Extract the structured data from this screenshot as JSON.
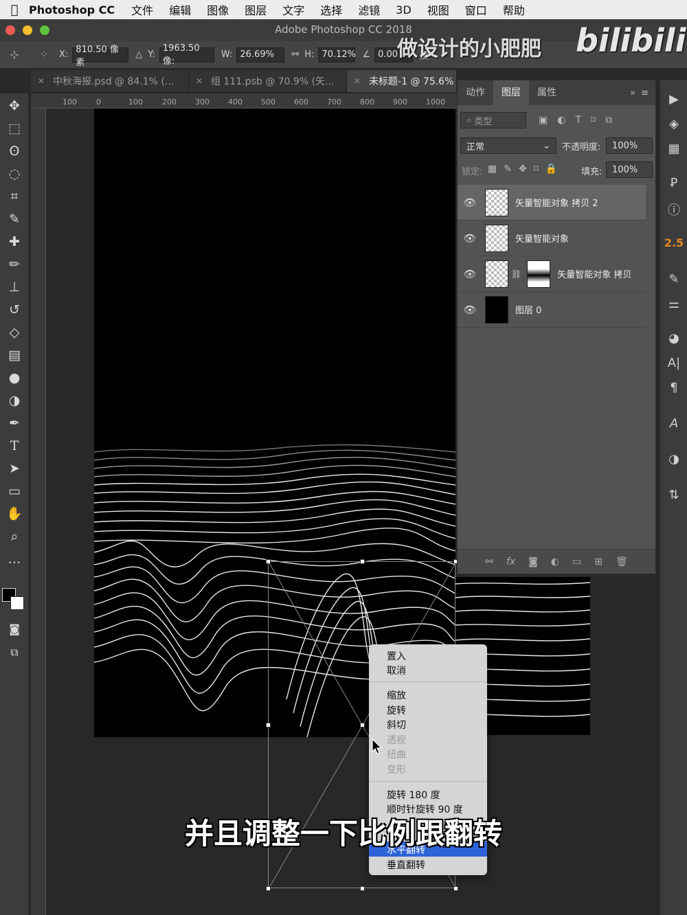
{
  "menubar": {
    "app": "Photoshop CC",
    "items": [
      "文件",
      "编辑",
      "图像",
      "图层",
      "文字",
      "选择",
      "滤镜",
      "3D",
      "视图",
      "窗口",
      "帮助"
    ]
  },
  "window_title": "Adobe Photoshop CC 2018",
  "options": {
    "x_label": "X:",
    "x_value": "810.50 像素",
    "y_label": "Y:",
    "y_value": "1963.50 像:",
    "w_label": "W:",
    "w_value": "26.69%",
    "h_label": "H:",
    "h_value": "70.12%",
    "angle_value": "0.00",
    "angle_unit": "度"
  },
  "doc_tabs": [
    {
      "label": "中秋海报.psd @ 84.1% (...",
      "active": false
    },
    {
      "label": "组 111.psb @ 70.9% (矢...",
      "active": false
    },
    {
      "label": "未标题-1 @ 75.6%",
      "active": true
    }
  ],
  "ruler_ticks": [
    "100",
    "0",
    "100",
    "200",
    "300",
    "400",
    "500",
    "600",
    "700",
    "800",
    "900",
    "1000"
  ],
  "panel": {
    "tabs": [
      "动作",
      "图层",
      "属性"
    ],
    "active_tab": "图层",
    "filter_placeholder": "类型",
    "blend_mode": "正常",
    "opacity_label": "不透明度:",
    "opacity_value": "100%",
    "lock_label": "锁定:",
    "fill_label": "填充:",
    "fill_value": "100%",
    "layers": [
      {
        "name": "矢量智能对象 拷贝 2",
        "selected": true
      },
      {
        "name": "矢量智能对象",
        "selected": false
      },
      {
        "name": "矢量智能对象 拷贝",
        "selected": false
      },
      {
        "name": "图层 0",
        "selected": false
      }
    ]
  },
  "context_menu": {
    "items": [
      "置入",
      "取消",
      "缩放",
      "旋转",
      "斜切",
      "透视",
      "扭曲",
      "变形",
      "旋转 180 度",
      "顺时针旋转 90 度",
      "水平翻转",
      "垂直翻转"
    ],
    "disabled": [
      "透视",
      "扭曲",
      "变形"
    ],
    "highlighted": "水平翻转"
  },
  "right_strip_value": "2.5",
  "subtitle": "并且调整一下比例跟翻转",
  "watermark": "做设计的小肥肥",
  "watermark_logo": "bilibili",
  "colors": {
    "highlight": "#2f63d8",
    "panel_bg": "#535353",
    "canvas": "#000000"
  }
}
